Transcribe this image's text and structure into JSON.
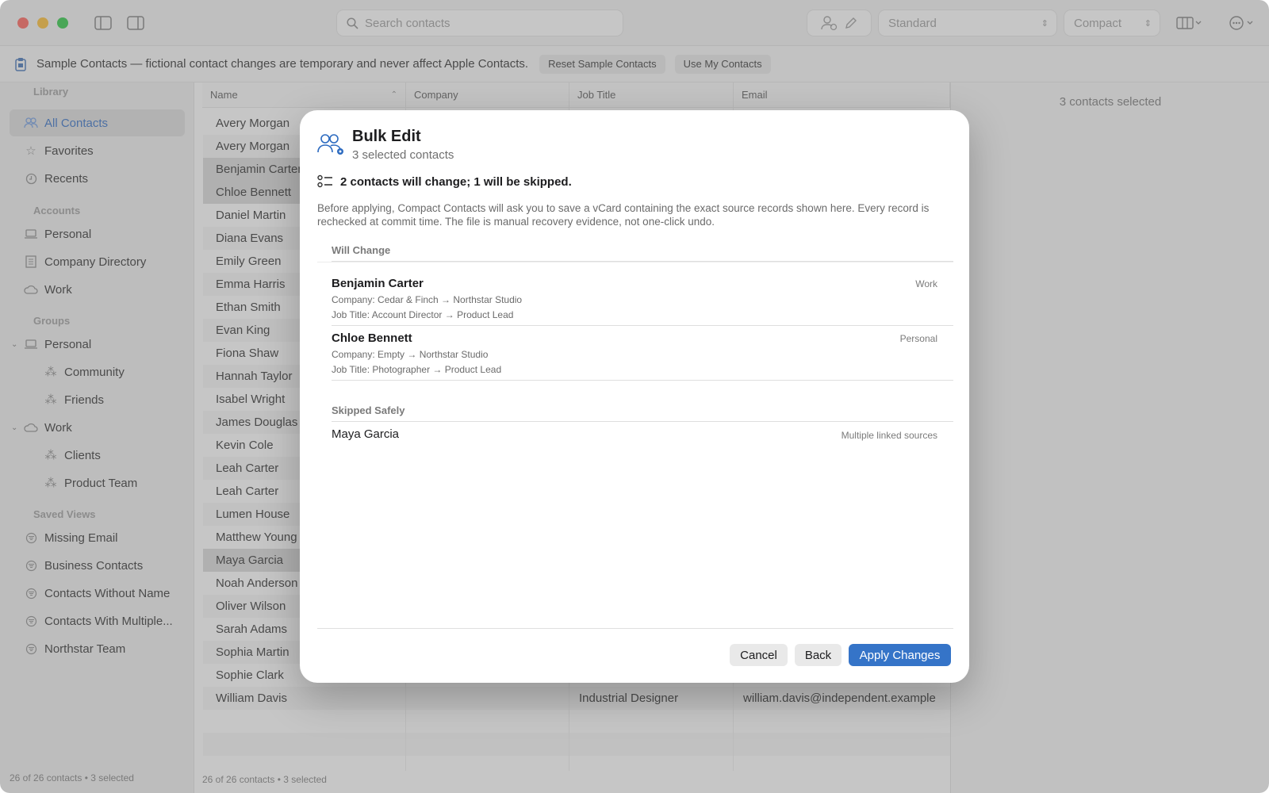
{
  "toolbar": {
    "search_placeholder": "Search contacts",
    "sort_style": "Standard",
    "density": "Compact"
  },
  "banner": {
    "text": "Sample Contacts — fictional contact changes are temporary and never affect Apple Contacts.",
    "reset_label": "Reset Sample Contacts",
    "use_mine_label": "Use My Contacts"
  },
  "sidebar": {
    "library_label": "Library",
    "all_contacts": "All Contacts",
    "favorites": "Favorites",
    "recents": "Recents",
    "accounts_label": "Accounts",
    "acct_personal": "Personal",
    "acct_company": "Company Directory",
    "acct_work": "Work",
    "groups_label": "Groups",
    "grp_personal": "Personal",
    "grp_community": "Community",
    "grp_friends": "Friends",
    "grp_work": "Work",
    "grp_clients": "Clients",
    "grp_product": "Product Team",
    "saved_label": "Saved Views",
    "sv_missing_email": "Missing Email",
    "sv_business": "Business Contacts",
    "sv_without_name": "Contacts Without Name",
    "sv_multiple": "Contacts With Multiple...",
    "sv_northstar": "Northstar Team",
    "footer": "26 of 26 contacts • 3 selected"
  },
  "table": {
    "headers": {
      "name": "Name",
      "company": "Company",
      "job": "Job Title",
      "email": "Email"
    },
    "rows": [
      "Avery Morgan",
      "Avery Morgan",
      "Benjamin Carter",
      "Chloe Bennett",
      "Daniel Martin",
      "Diana Evans",
      "Emily Green",
      "Emma Harris",
      "Ethan Smith",
      "Evan King",
      "Fiona Shaw",
      "Hannah Taylor",
      "Isabel Wright",
      "James Douglas",
      "Kevin Cole",
      "Leah Carter",
      "Leah Carter",
      "Lumen House",
      "Matthew Young",
      "Maya Garcia",
      "Noah Anderson",
      "Oliver Wilson",
      "Sarah Adams",
      "Sophia Martin",
      "Sophie Clark",
      "William Davis"
    ],
    "last_row_job": "Industrial Designer",
    "last_row_email": "william.davis@independent.example",
    "footer": "26 of 26 contacts • 3 selected"
  },
  "detail": {
    "text": "3 contacts selected"
  },
  "modal": {
    "title": "Bulk Edit",
    "subtitle": "3 selected contacts",
    "summary": "2 contacts will change; 1 will be skipped.",
    "description": "Before applying, Compact Contacts will ask you to save a vCard containing the exact source records shown here. Every record is rechecked at commit time. The file is manual recovery evidence, not one-click undo.",
    "will_change_label": "Will Change",
    "changes": [
      {
        "name": "Benjamin Carter",
        "account": "Work",
        "company": "Company: Cedar & Finch → Northstar Studio",
        "job": "Job Title: Account Director → Product Lead"
      },
      {
        "name": "Chloe Bennett",
        "account": "Personal",
        "company": "Company: Empty → Northstar Studio",
        "job": "Job Title: Photographer → Product Lead"
      }
    ],
    "skipped_label": "Skipped Safely",
    "skipped": [
      {
        "name": "Maya Garcia",
        "reason": "Multiple linked sources"
      }
    ],
    "cancel": "Cancel",
    "back": "Back",
    "apply": "Apply Changes"
  }
}
